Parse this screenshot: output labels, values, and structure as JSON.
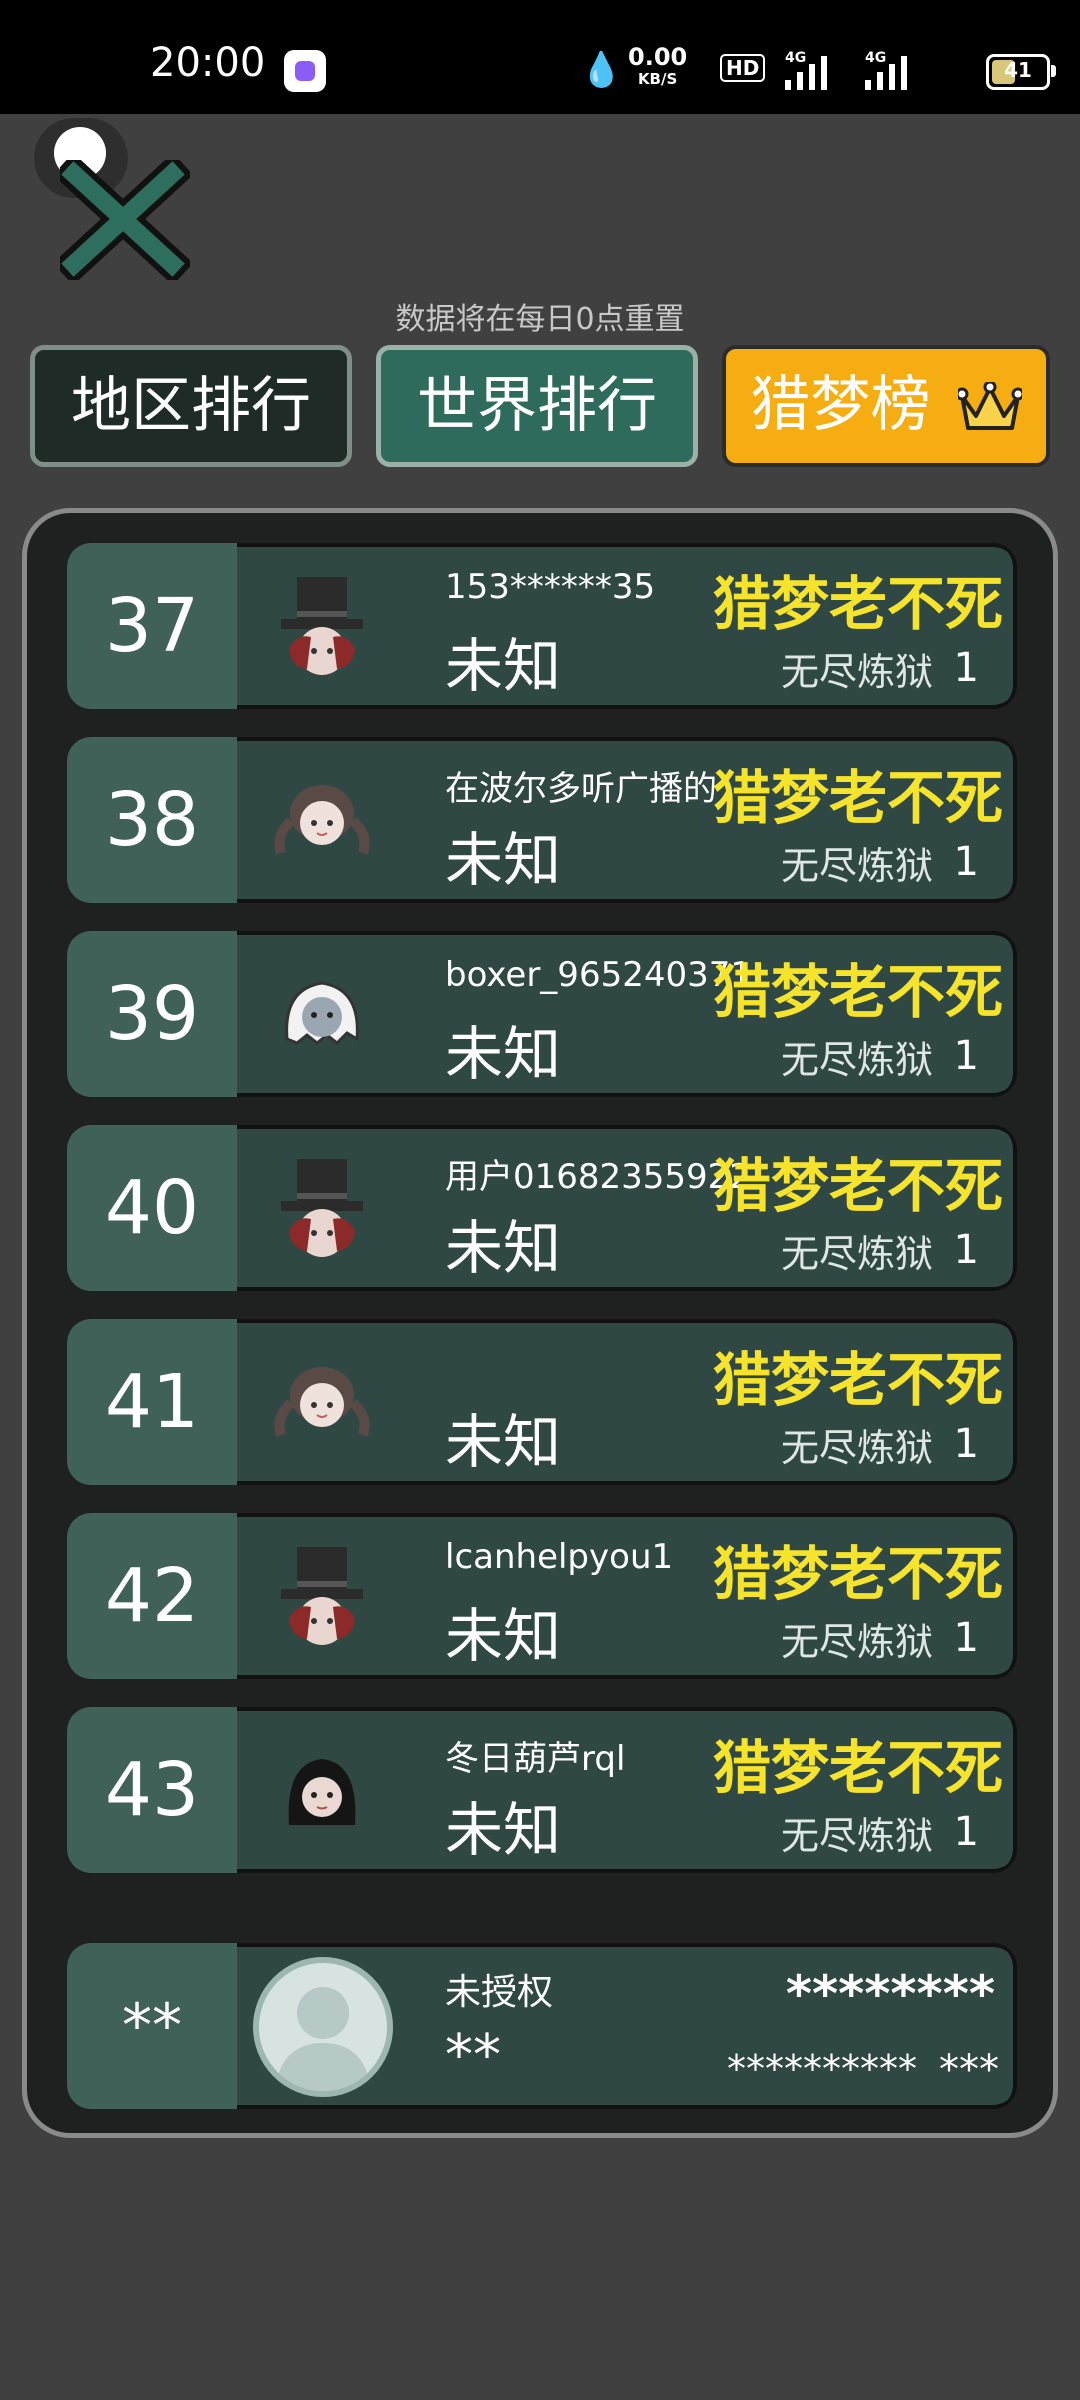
{
  "status_bar": {
    "time": "20:00",
    "net_speed": "0.00",
    "net_unit": "KB/S",
    "hd": "HD",
    "signal1": "4G",
    "signal2": "4G",
    "battery": "41"
  },
  "notice": "数据将在每日0点重置",
  "tabs": {
    "region": "地区排行",
    "world": "世界排行",
    "hunt": "猎梦榜"
  },
  "rows": [
    {
      "rank": "37",
      "name": "153******35",
      "region": "未知",
      "title": "猎梦老不死",
      "mode": "无尽炼狱",
      "score": "1",
      "avatar": "top-hat-avatar"
    },
    {
      "rank": "38",
      "name": "在波尔多听广播的",
      "region": "未知",
      "title": "猎梦老不死",
      "mode": "无尽炼狱",
      "score": "1",
      "avatar": "braids-girl-avatar"
    },
    {
      "rank": "39",
      "name": "boxer_965240371",
      "region": "未知",
      "title": "猎梦老不死",
      "mode": "无尽炼狱",
      "score": "1",
      "avatar": "ghost-avatar"
    },
    {
      "rank": "40",
      "name": "用户01682355922",
      "region": "未知",
      "title": "猎梦老不死",
      "mode": "无尽炼狱",
      "score": "1",
      "avatar": "top-hat-avatar"
    },
    {
      "rank": "41",
      "name": "",
      "region": "未知",
      "title": "猎梦老不死",
      "mode": "无尽炼狱",
      "score": "1",
      "avatar": "braids-girl-avatar"
    },
    {
      "rank": "42",
      "name": "lcanhelpyou1",
      "region": "未知",
      "title": "猎梦老不死",
      "mode": "无尽炼狱",
      "score": "1",
      "avatar": "top-hat-avatar"
    },
    {
      "rank": "43",
      "name": "冬日葫芦rql",
      "region": "未知",
      "title": "猎梦老不死",
      "mode": "无尽炼狱",
      "score": "1",
      "avatar": "black-hair-girl-avatar"
    }
  ],
  "self": {
    "rank": "**",
    "name": "未授权",
    "region": "**",
    "title": "********",
    "mode": "**********",
    "score": "***"
  },
  "colors": {
    "background": "#404040",
    "gold_tab": "#f6ad11",
    "title_yellow": "#f5e32c",
    "row": "#2f4843",
    "rank_cell": "#3f6158"
  }
}
